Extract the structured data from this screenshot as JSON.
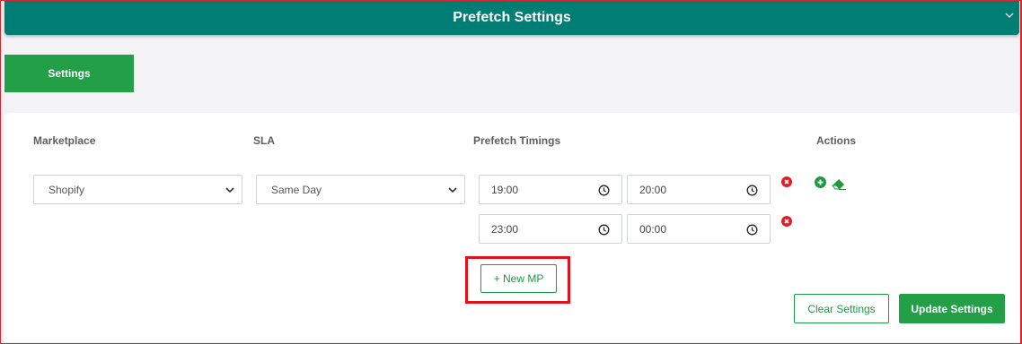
{
  "header": {
    "title": "Prefetch Settings"
  },
  "tabs": {
    "settings": "Settings"
  },
  "columns": {
    "marketplace": "Marketplace",
    "sla": "SLA",
    "timings": "Prefetch Timings",
    "actions": "Actions"
  },
  "row": {
    "marketplace": "Shopify",
    "sla": "Same Day",
    "timings": [
      {
        "start": "19:00",
        "end": "20:00"
      },
      {
        "start": "23:00",
        "end": "00:00"
      }
    ]
  },
  "buttons": {
    "new_mp": "+ New MP",
    "clear": "Clear Settings",
    "update": "Update Settings"
  },
  "colors": {
    "header": "#017e74",
    "primary_green": "#23a047",
    "remove_red": "#dc1f26",
    "highlight_red": "#e0121d"
  }
}
